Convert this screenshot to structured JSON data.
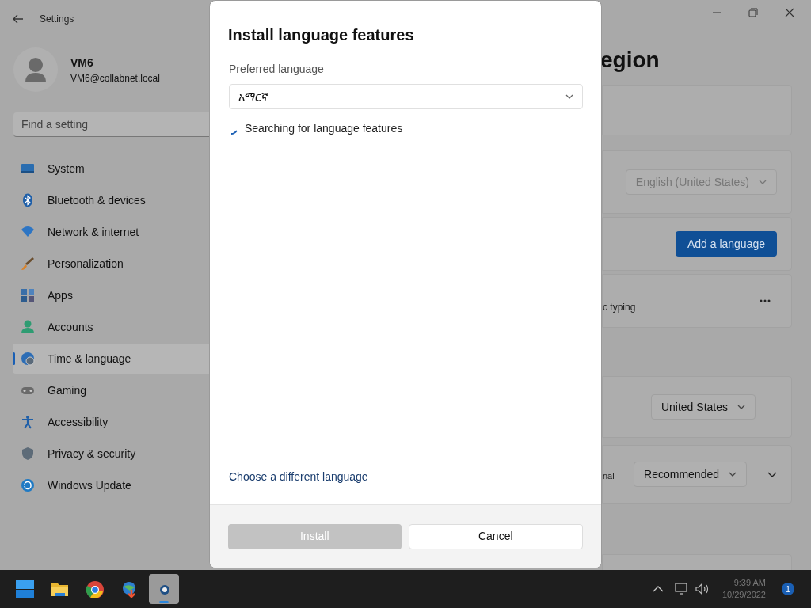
{
  "settings_window": {
    "title": "Settings",
    "user": {
      "name": "VM6",
      "email": "VM6@collabnet.local"
    },
    "search": {
      "placeholder": "Find a setting"
    },
    "nav_items": [
      {
        "label": "System",
        "selected": false
      },
      {
        "label": "Bluetooth & devices",
        "selected": false
      },
      {
        "label": "Network & internet",
        "selected": false
      },
      {
        "label": "Personalization",
        "selected": false
      },
      {
        "label": "Apps",
        "selected": false
      },
      {
        "label": "Accounts",
        "selected": false
      },
      {
        "label": "Time & language",
        "selected": true
      },
      {
        "label": "Gaming",
        "selected": false
      },
      {
        "label": "Accessibility",
        "selected": false
      },
      {
        "label": "Privacy & security",
        "selected": false
      },
      {
        "label": "Windows Update",
        "selected": false
      }
    ],
    "page_title": "egion",
    "cards": [
      {
        "kind": "blank"
      },
      {
        "kind": "dropdown",
        "value": "English (United States)",
        "disabled": true
      },
      {
        "kind": "button",
        "label": "Add a language"
      },
      {
        "kind": "overflow",
        "text": "c typing"
      },
      {
        "kind": "dropdown",
        "value": "United States",
        "disabled": false
      },
      {
        "kind": "dropdown_expand",
        "text": "nal",
        "value": "Recommended"
      },
      {
        "kind": "blank"
      }
    ]
  },
  "dialog": {
    "title": "Install language features",
    "field_label": "Preferred language",
    "select_value": "አማርኛ",
    "status": "Searching for language features",
    "link": "Choose a different language",
    "buttons": [
      {
        "label": "Install",
        "disabled": true
      },
      {
        "label": "Cancel",
        "disabled": false
      }
    ]
  },
  "taskbar": {
    "apps": [
      {
        "selected": false
      },
      {
        "selected": false
      },
      {
        "selected": false
      },
      {
        "selected": false
      },
      {
        "selected": true
      }
    ],
    "time": "9:39 AM",
    "date": "10/29/2022",
    "badge": "1"
  }
}
